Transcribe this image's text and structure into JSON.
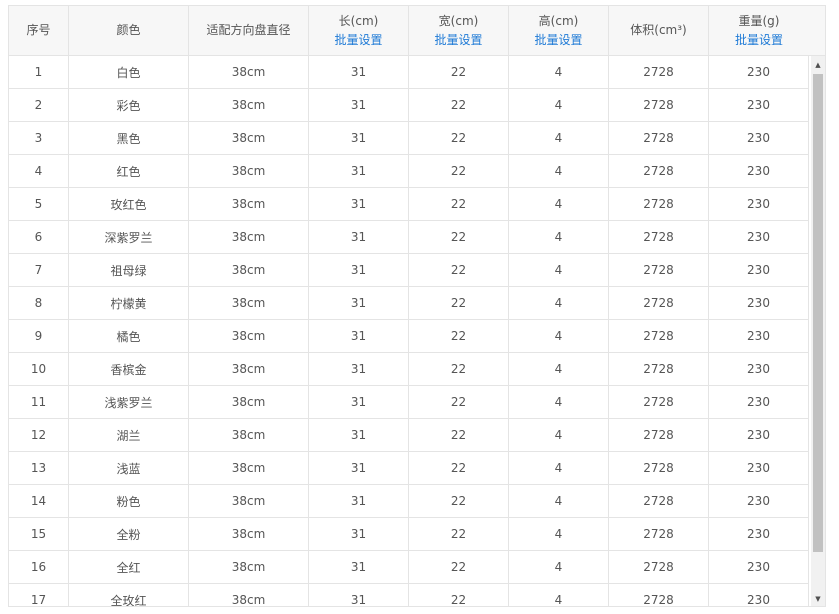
{
  "columns": [
    {
      "label": "序号",
      "action": ""
    },
    {
      "label": "颜色",
      "action": ""
    },
    {
      "label": "适配方向盘直径",
      "action": ""
    },
    {
      "label": "长(cm)",
      "action": "批量设置"
    },
    {
      "label": "宽(cm)",
      "action": "批量设置"
    },
    {
      "label": "高(cm)",
      "action": "批量设置"
    },
    {
      "label": "体积(cm³)",
      "action": ""
    },
    {
      "label": "重量(g)",
      "action": "批量设置"
    }
  ],
  "rows": [
    [
      "1",
      "白色",
      "38cm",
      "31",
      "22",
      "4",
      "2728",
      "230"
    ],
    [
      "2",
      "彩色",
      "38cm",
      "31",
      "22",
      "4",
      "2728",
      "230"
    ],
    [
      "3",
      "黑色",
      "38cm",
      "31",
      "22",
      "4",
      "2728",
      "230"
    ],
    [
      "4",
      "红色",
      "38cm",
      "31",
      "22",
      "4",
      "2728",
      "230"
    ],
    [
      "5",
      "玫红色",
      "38cm",
      "31",
      "22",
      "4",
      "2728",
      "230"
    ],
    [
      "6",
      "深紫罗兰",
      "38cm",
      "31",
      "22",
      "4",
      "2728",
      "230"
    ],
    [
      "7",
      "祖母绿",
      "38cm",
      "31",
      "22",
      "4",
      "2728",
      "230"
    ],
    [
      "8",
      "柠檬黄",
      "38cm",
      "31",
      "22",
      "4",
      "2728",
      "230"
    ],
    [
      "9",
      "橘色",
      "38cm",
      "31",
      "22",
      "4",
      "2728",
      "230"
    ],
    [
      "10",
      "香槟金",
      "38cm",
      "31",
      "22",
      "4",
      "2728",
      "230"
    ],
    [
      "11",
      "浅紫罗兰",
      "38cm",
      "31",
      "22",
      "4",
      "2728",
      "230"
    ],
    [
      "12",
      "湖兰",
      "38cm",
      "31",
      "22",
      "4",
      "2728",
      "230"
    ],
    [
      "13",
      "浅蓝",
      "38cm",
      "31",
      "22",
      "4",
      "2728",
      "230"
    ],
    [
      "14",
      "粉色",
      "38cm",
      "31",
      "22",
      "4",
      "2728",
      "230"
    ],
    [
      "15",
      "全粉",
      "38cm",
      "31",
      "22",
      "4",
      "2728",
      "230"
    ],
    [
      "16",
      "全红",
      "38cm",
      "31",
      "22",
      "4",
      "2728",
      "230"
    ],
    [
      "17",
      "全玫红",
      "38cm",
      "31",
      "22",
      "4",
      "2728",
      "230"
    ]
  ],
  "scrollbar": {
    "up_icon": "triangle-up-icon",
    "down_icon": "triangle-down-icon"
  },
  "colors": {
    "link": "#1e7ad6",
    "header_bg": "#f7f7f7",
    "border": "#e4e4e4",
    "text": "#555555"
  }
}
